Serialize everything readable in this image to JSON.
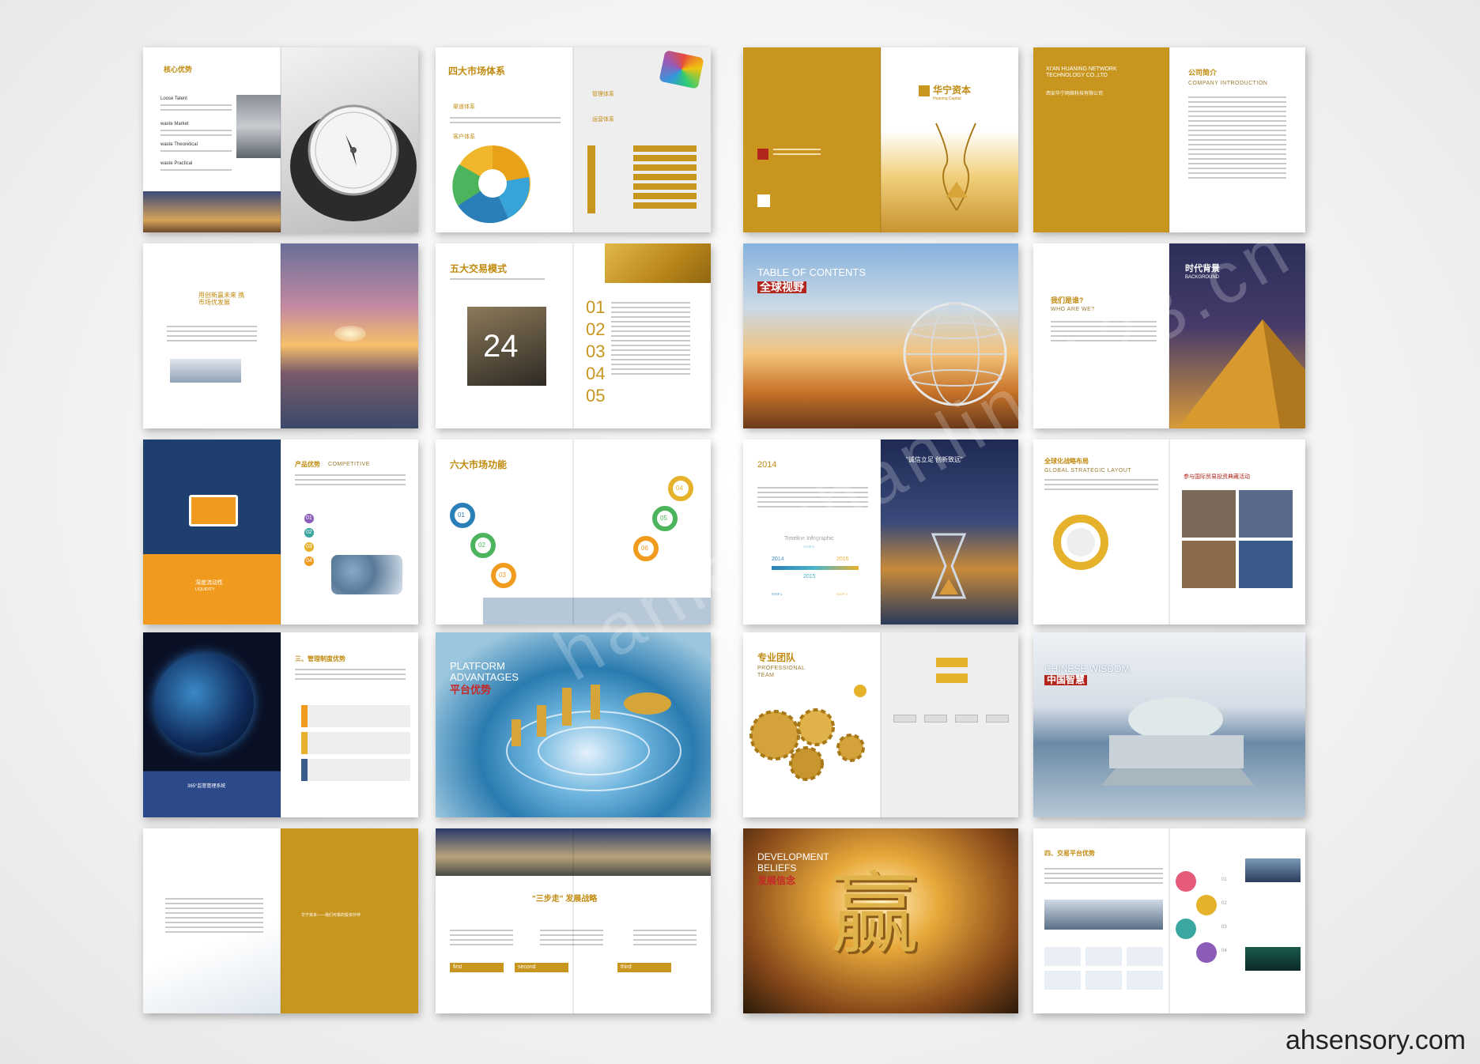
{
  "watermark_text": "hanlei.zhanling123.cn",
  "site_label": "ahsensory.com",
  "pages": {
    "p01": {
      "title_cn": "核心优势",
      "items": [
        "Loose Talent",
        "waste Market",
        "waste Theoretical",
        "waste Practical"
      ]
    },
    "p02": {
      "title_cn": "四大市场体系",
      "sub1": "渠道体系",
      "sub2": "管理体系",
      "sub3": "运营体系",
      "sub4": "客户体系"
    },
    "p03": {
      "logo": "华宁资本",
      "logo_en": "Huaning Capital"
    },
    "p04": {
      "company_en": "XI'AN HUANING NETWORK TECHNOLOGY CO.,LTD",
      "company_cn": "西安华宁网络科技有限公司",
      "intro_cn": "公司简介",
      "intro_en": "COMPANY INTRODUCTION"
    },
    "p05": {
      "slogan": "用创新赢未来 携市场优发展"
    },
    "p06": {
      "title_cn": "五大交易模式",
      "big_number": "24",
      "nums": [
        "01",
        "02",
        "03",
        "04",
        "05"
      ]
    },
    "p07": {
      "toc_en": "TABLE OF CONTENTS",
      "toc_cn": "全球视野"
    },
    "p08": {
      "q_cn": "我们是谁?",
      "q_en": "WHO ARE WE?",
      "bg_cn": "时代背景",
      "bg_en": "BACKGROUND"
    },
    "p09": {
      "title_cn": "产品优势",
      "title_en": "COMPETITIVE",
      "bottom_cn": "深度流动性",
      "bottom_en": "LIQUIDITY",
      "nums": [
        "01",
        "02",
        "03",
        "04"
      ]
    },
    "p10": {
      "title_cn": "六大市场功能",
      "nums": [
        "01",
        "02",
        "03",
        "04",
        "05",
        "06"
      ]
    },
    "p11": {
      "year": "2014",
      "motto": "\"诚信立足 创新致远\"",
      "timeline": "Timeline Infographic",
      "years": [
        "2014",
        "2015",
        "2016"
      ],
      "steps": [
        "STEP 1",
        "STEP 2",
        "STEP 3"
      ]
    },
    "p12": {
      "title_cn": "全球化战略布局",
      "title_en": "GLOBAL STRATEGIC LAYOUT",
      "sub_cn": "参与国际贸易投资典藏活动"
    },
    "p13": {
      "title_cn": "三、管理制度优势",
      "label": "365°监管管理系统"
    },
    "p14": {
      "title_en1": "PLATFORM",
      "title_en2": "ADVANTAGES",
      "title_cn": "平台优势"
    },
    "p15": {
      "title_cn": "专业团队",
      "title_en1": "PROFESSIONAL",
      "title_en2": "TEAM"
    },
    "p16": {
      "title_en": "CHINESE WISDOM",
      "title_cn": "中国智慧"
    },
    "p17": {
      "gold_text": "华宁资本——我们可靠的投资伙伴"
    },
    "p18": {
      "title_cn": "\"三步走\" 发展战略",
      "steps": [
        "first",
        "second",
        "third"
      ]
    },
    "p19": {
      "title_en1": "DEVELOPMENT",
      "title_en2": "BELIEFS",
      "title_cn": "发展信念",
      "big_char": "赢"
    },
    "p20": {
      "title_cn": "四、交易平台优势",
      "circle_nums": [
        "01",
        "02",
        "03",
        "04"
      ]
    }
  }
}
